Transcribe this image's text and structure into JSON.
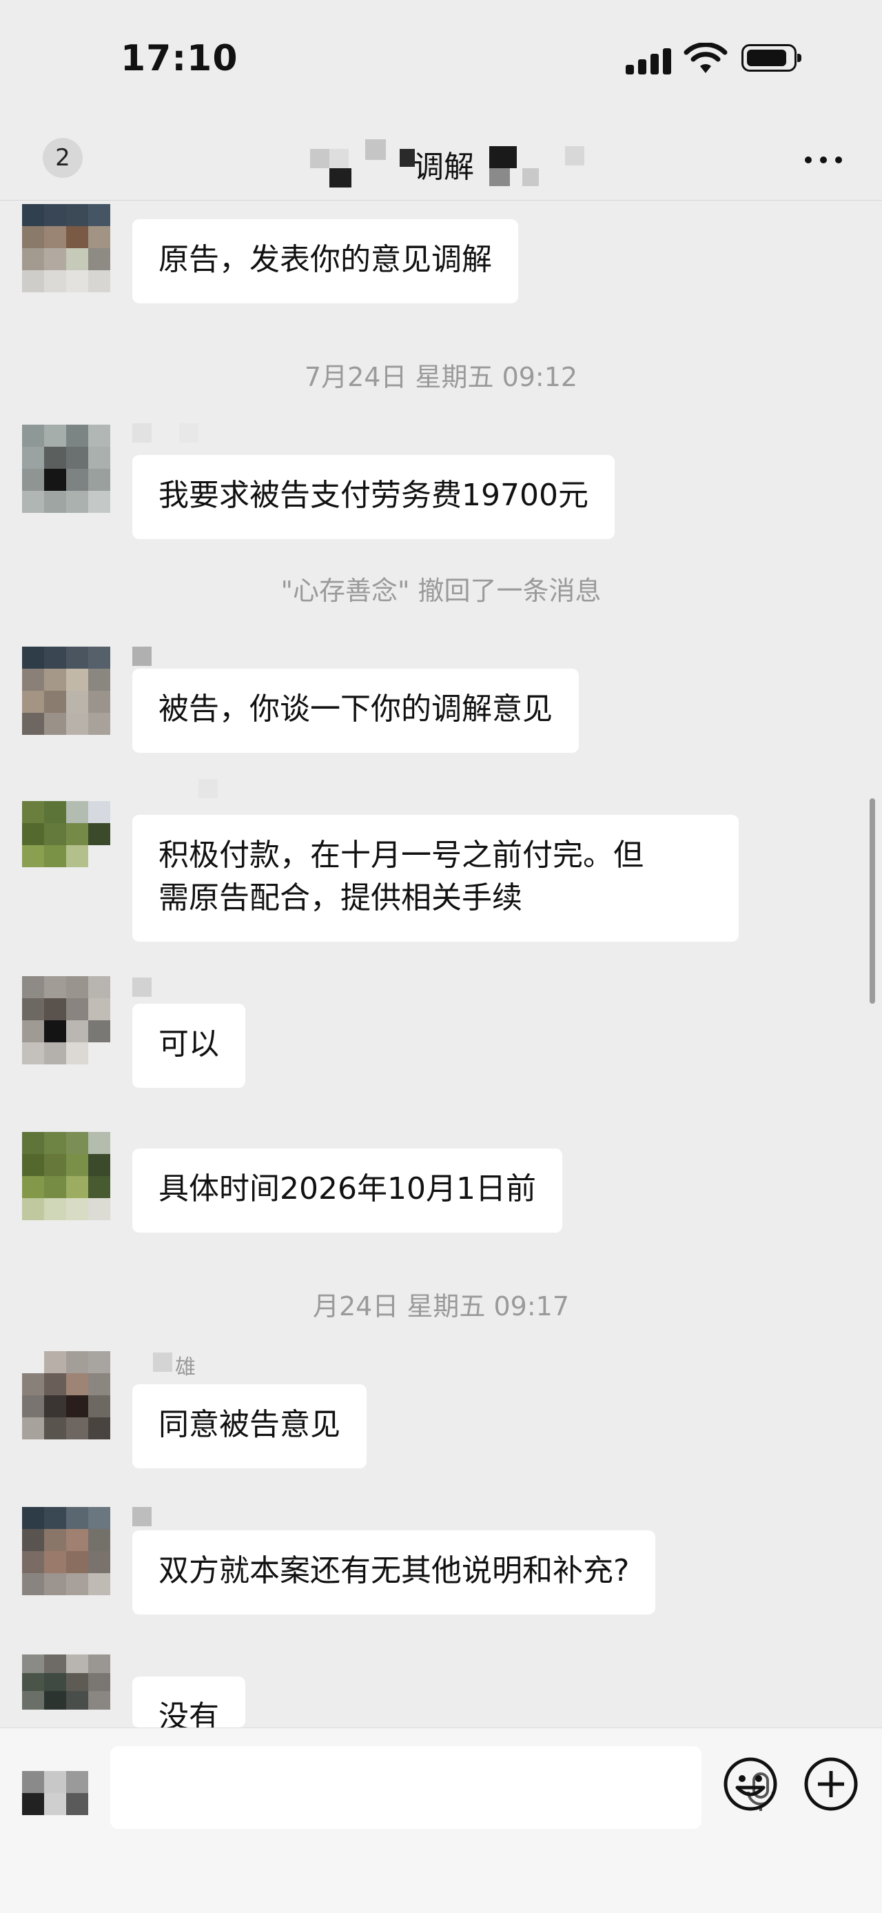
{
  "status_bar": {
    "time": "17:10"
  },
  "header": {
    "badge": "2",
    "title": "调解",
    "more": "···"
  },
  "messages": [
    {
      "text": "原告，发表你的意见调解"
    },
    {
      "timestamp": "7月24日 星期五 09:12"
    },
    {
      "text": "我要求被告支付劳务费19700元"
    },
    {
      "recall": "\"心存善念\" 撤回了一条消息"
    },
    {
      "text": "被告，你谈一下你的调解意见"
    },
    {
      "text": "积极付款，在十月一号之前付完。但\n需原告配合，提供相关手续"
    },
    {
      "text": "可以"
    },
    {
      "text": "具体时间2026年10月1日前"
    },
    {
      "timestamp": "月24日 星期五 09:17"
    },
    {
      "sender": "雄",
      "text": "同意被告意见"
    },
    {
      "text": "双方就本案还有无其他说明和补充?"
    },
    {
      "text": "没有"
    }
  ],
  "icons": {
    "voice": "voice-toggle-icon",
    "mic": "microphone-icon",
    "emoji": "emoji-icon",
    "plus": "plus-icon",
    "more": "more-icon"
  },
  "colors": {
    "background": "#ededed",
    "bubble": "#ffffff",
    "system_text": "#9a9a9a"
  }
}
